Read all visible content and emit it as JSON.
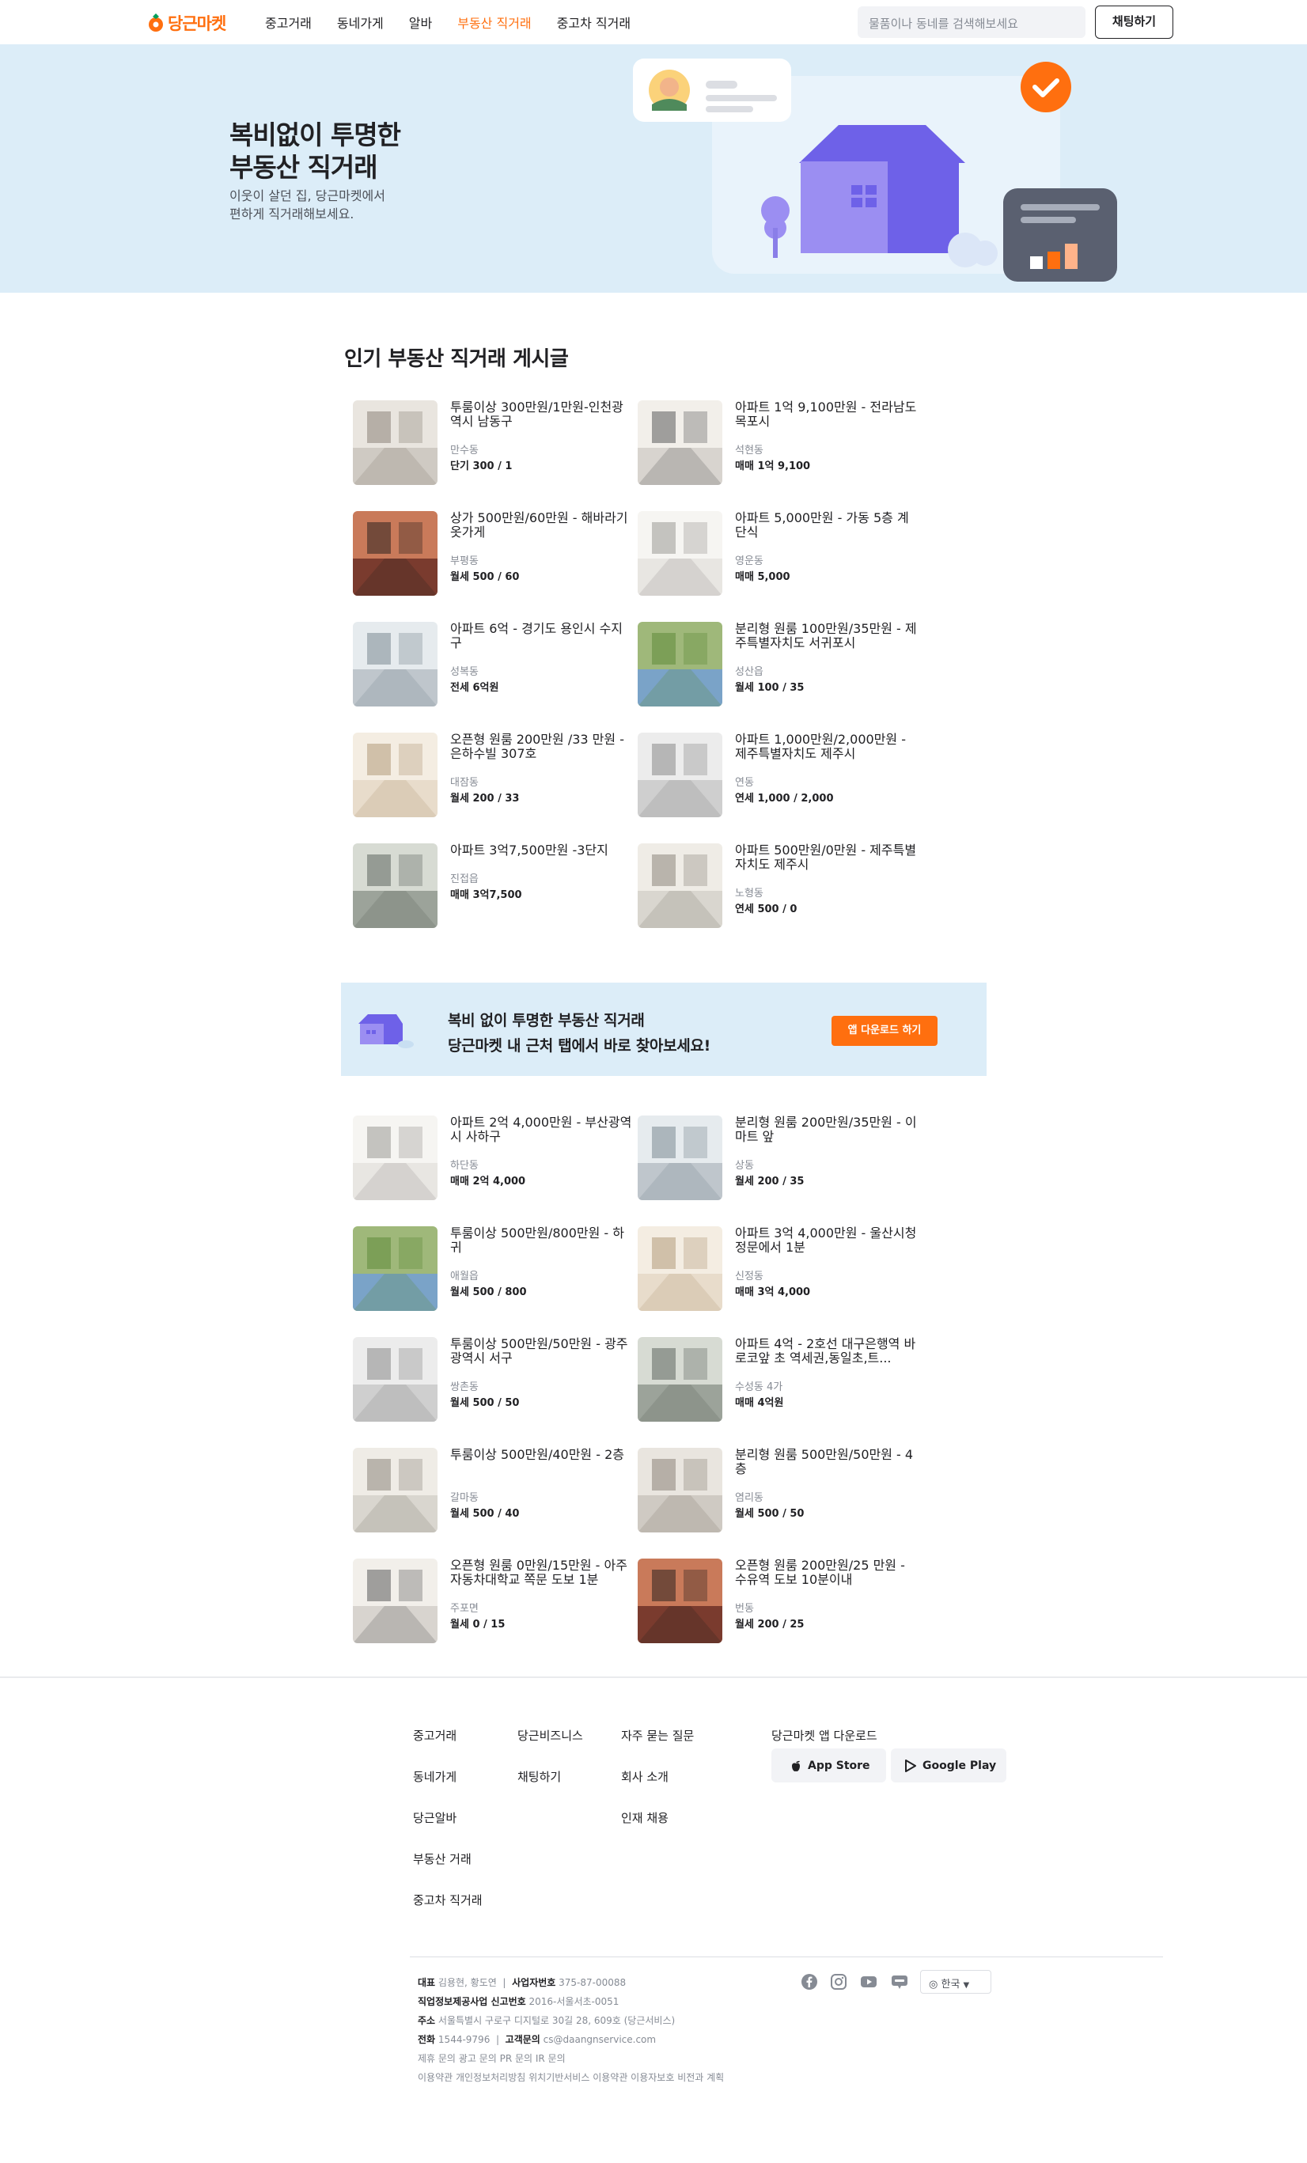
{
  "header": {
    "logo": "당근마켓",
    "nav": [
      "중고거래",
      "동네가게",
      "알바",
      "부동산 직거래",
      "중고차 직거래"
    ],
    "active_nav": "부동산 직거래",
    "search_placeholder": "물품이나 동네를 검색해보세요",
    "chat_button": "채팅하기"
  },
  "hero": {
    "title": "복비없이 투명한\n부동산 직거래",
    "subtitle": "이웃이 살던 집, 당근마켓에서\n편하게 직거래해보세요."
  },
  "section_title": "인기 부동산 직거래 게시글",
  "listings_top": [
    {
      "title": "투룸이상 300만원/1만원-인천광역시 남동구",
      "location": "만수동",
      "price": "단기 300 / 1"
    },
    {
      "title": "아파트 1억 9,100만원 - 전라남도 목포시",
      "location": "석현동",
      "price": "매매 1억 9,100"
    },
    {
      "title": "상가 500만원/60만원 - 해바라기 옷가게",
      "location": "부평동",
      "price": "월세 500 / 60"
    },
    {
      "title": "아파트 5,000만원 - 가동 5층 계단식",
      "location": "영운동",
      "price": "매매 5,000"
    },
    {
      "title": "아파트 6억 - 경기도 용인시 수지구",
      "location": "성복동",
      "price": "전세 6억원"
    },
    {
      "title": "분리형 원룸 100만원/35만원 - 제주특별자치도 서귀포시",
      "location": "성산읍",
      "price": "월세 100 / 35"
    },
    {
      "title": "오픈형 원룸 200만원 /33 만원 - 은하수빌 307호",
      "location": "대잠동",
      "price": "월세 200 / 33"
    },
    {
      "title": "아파트 1,000만원/2,000만원 - 제주특별자치도 제주시",
      "location": "연동",
      "price": "연세 1,000 / 2,000"
    },
    {
      "title": "아파트 3억7,500만원 -3단지",
      "location": "진접읍",
      "price": "매매 3억7,500"
    },
    {
      "title": "아파트 500만원/0만원 - 제주특별자치도 제주시",
      "location": "노형동",
      "price": "연세 500 / 0"
    }
  ],
  "banner": {
    "text": "복비 없이 투명한 부동산 직거래\n당근마켓 내 근처 탭에서 바로 찾아보세요!",
    "button": "앱 다운로드 하기"
  },
  "listings_bottom": [
    {
      "title": "아파트 2억 4,000만원 - 부산광역시 사하구",
      "location": "하단동",
      "price": "매매 2억 4,000"
    },
    {
      "title": "분리형 원룸 200만원/35만원 - 이마트 앞",
      "location": "상동",
      "price": "월세 200 / 35"
    },
    {
      "title": "투룸이상 500만원/800만원 - 하귀",
      "location": "애월읍",
      "price": "월세 500 / 800"
    },
    {
      "title": "아파트 3억 4,000만원 - 울산시청 정문에서 1분",
      "location": "신정동",
      "price": "매매 3억 4,000"
    },
    {
      "title": "투룸이상 500만원/50만원 - 광주광역시 서구",
      "location": "쌍촌동",
      "price": "월세 500 / 50"
    },
    {
      "title": "아파트 4억 - 2호선 대구은행역 바로코앞 초 역세권,동일초,트...",
      "location": "수성동 4가",
      "price": "매매 4억원"
    },
    {
      "title": "투룸이상 500만원/40만원 - 2층",
      "location": "갈마동",
      "price": "월세 500 / 40"
    },
    {
      "title": "분리형 원룸 500만원/50만원 - 4층",
      "location": "염리동",
      "price": "월세 500 / 50"
    },
    {
      "title": "오픈형 원룸 0만원/15만원 - 아주자동차대학교 쪽문 도보 1분",
      "location": "주포면",
      "price": "월세 0 / 15"
    },
    {
      "title": "오픈형 원룸 200만원/25 만원 - 수유역 도보 10분이내",
      "location": "번동",
      "price": "월세 200 / 25"
    }
  ],
  "footer": {
    "col1": [
      "중고거래",
      "동네가게",
      "당근알바",
      "부동산 거래",
      "중고차 직거래"
    ],
    "col2": [
      "당근비즈니스",
      "채팅하기"
    ],
    "col3": [
      "자주 묻는 질문",
      "회사 소개",
      "인재 채용"
    ],
    "app_heading": "당근마켓 앱 다운로드",
    "app_store": "App Store",
    "google_play": "Google Play",
    "info": {
      "ceo_label": "대표",
      "ceo": "김용현, 황도연",
      "biz_label": "사업자번호",
      "biz": "375-87-00088",
      "report_label": "직업정보제공사업 신고번호",
      "report": "2016-서울서초-0051",
      "address_label": "주소",
      "address": "서울특별시 구로구 디지털로 30길 28, 609호 (당근서비스)",
      "phone_label": "전화",
      "phone": "1544-9796",
      "email_label": "고객문의",
      "email": "cs@daangnservice.com",
      "contact": "제휴 문의  광고 문의  PR 문의  IR 문의",
      "terms": "이용약관  개인정보처리방침  위치기반서비스 이용약관  이용자보호 비전과 계획"
    },
    "language": "한국"
  },
  "colors": {
    "brand": "#ff6f0f",
    "hero_bg": "#dcedf8",
    "text": "#212124",
    "muted": "#868b94"
  }
}
